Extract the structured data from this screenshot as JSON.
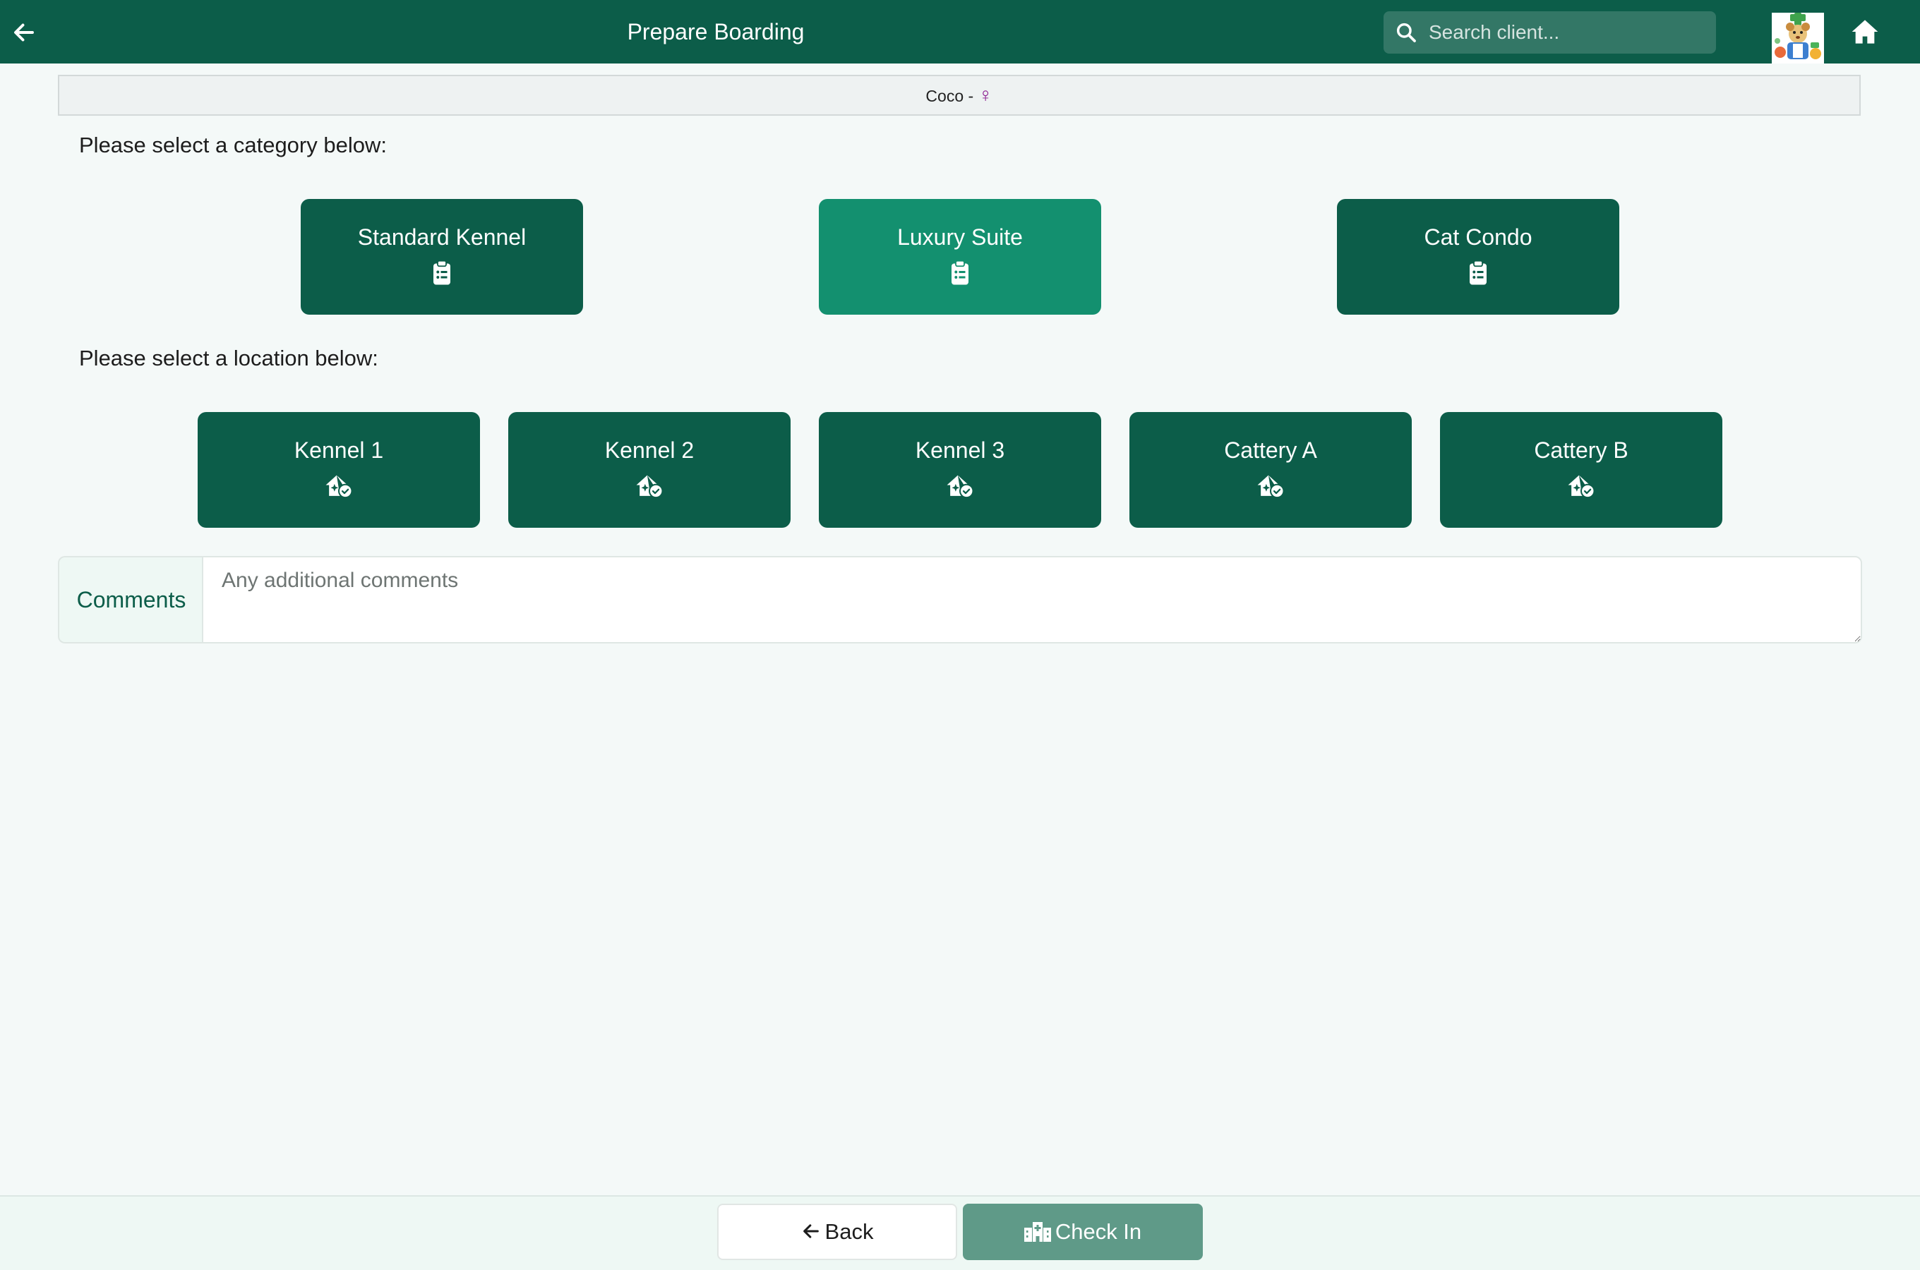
{
  "header": {
    "title": "Prepare Boarding",
    "search_placeholder": "Search client..."
  },
  "patient": {
    "name": "Coco -",
    "sex_symbol": "♀"
  },
  "category": {
    "prompt": "Please select a category below:",
    "selected": "Luxury Suite",
    "options": [
      {
        "label": "Standard Kennel"
      },
      {
        "label": "Luxury Suite"
      },
      {
        "label": "Cat Condo"
      }
    ]
  },
  "location": {
    "prompt": "Please select a location below:",
    "options": [
      {
        "label": "Kennel 1"
      },
      {
        "label": "Kennel 2"
      },
      {
        "label": "Kennel 3"
      },
      {
        "label": "Cattery A"
      },
      {
        "label": "Cattery B"
      }
    ]
  },
  "comments": {
    "label": "Comments",
    "placeholder": "Any additional comments",
    "value": ""
  },
  "footer": {
    "back_label": "Back",
    "checkin_label": "Check In"
  },
  "colors": {
    "primary": "#0c5d49",
    "selected": "#13906f",
    "checkin_disabled": "#5f9a88",
    "background": "#f4f9f8"
  }
}
